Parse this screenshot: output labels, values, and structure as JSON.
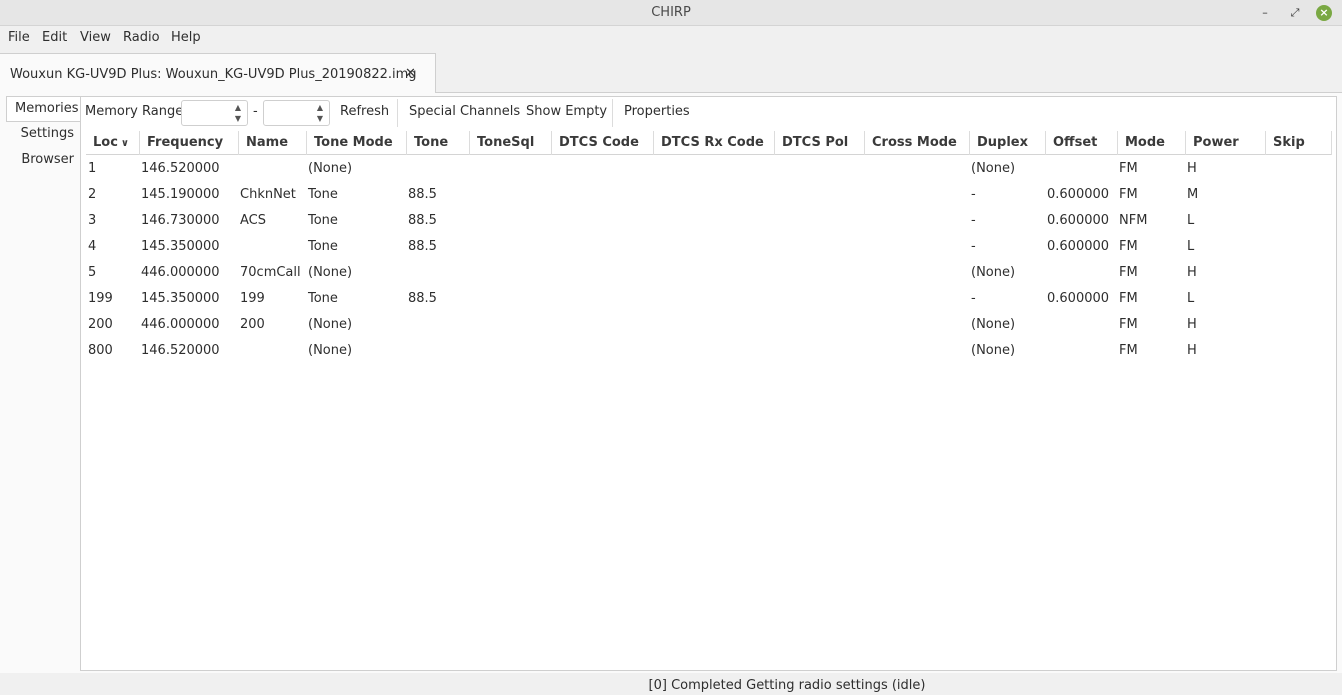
{
  "window": {
    "title": "CHIRP"
  },
  "menu": {
    "file": "File",
    "edit": "Edit",
    "view": "View",
    "radio": "Radio",
    "help": "Help"
  },
  "tab": {
    "label": "Wouxun KG-UV9D Plus: Wouxun_KG-UV9D Plus_20190822.img",
    "close": "✕"
  },
  "sidebar": {
    "memories": "Memories",
    "settings": "Settings",
    "browser": "Browser"
  },
  "toolbar": {
    "range_label": "Memory Range:",
    "range_start": "",
    "range_sep": "-",
    "range_end": "",
    "refresh": "Refresh",
    "special": "Special Channels",
    "show_empty": "Show Empty",
    "properties": "Properties"
  },
  "columns": [
    "Loc",
    "Frequency",
    "Name",
    "Tone Mode",
    "Tone",
    "ToneSql",
    "DTCS Code",
    "DTCS Rx Code",
    "DTCS Pol",
    "Cross Mode",
    "Duplex",
    "Offset",
    "Mode",
    "Power",
    "Skip"
  ],
  "sort_indicator": "∨",
  "rows": [
    [
      "1",
      "146.520000",
      "",
      "(None)",
      "",
      "",
      "",
      "",
      "",
      "",
      "(None)",
      "",
      "FM",
      "H",
      ""
    ],
    [
      "2",
      "145.190000",
      "ChknNet",
      "Tone",
      "88.5",
      "",
      "",
      "",
      "",
      "",
      "-",
      "0.600000",
      "FM",
      "M",
      ""
    ],
    [
      "3",
      "146.730000",
      "ACS",
      "Tone",
      "88.5",
      "",
      "",
      "",
      "",
      "",
      "-",
      "0.600000",
      "NFM",
      "L",
      ""
    ],
    [
      "4",
      "145.350000",
      "",
      "Tone",
      "88.5",
      "",
      "",
      "",
      "",
      "",
      "-",
      "0.600000",
      "FM",
      "L",
      ""
    ],
    [
      "5",
      "446.000000",
      "70cmCall",
      "(None)",
      "",
      "",
      "",
      "",
      "",
      "",
      "(None)",
      "",
      "FM",
      "H",
      ""
    ],
    [
      "199",
      "145.350000",
      "199",
      "Tone",
      "88.5",
      "",
      "",
      "",
      "",
      "",
      "-",
      "0.600000",
      "FM",
      "L",
      ""
    ],
    [
      "200",
      "446.000000",
      "200",
      "(None)",
      "",
      "",
      "",
      "",
      "",
      "",
      "(None)",
      "",
      "FM",
      "H",
      ""
    ],
    [
      "800",
      "146.520000",
      "",
      "(None)",
      "",
      "",
      "",
      "",
      "",
      "",
      "(None)",
      "",
      "FM",
      "H",
      ""
    ]
  ],
  "status": "[0] Completed Getting radio settings (idle)"
}
